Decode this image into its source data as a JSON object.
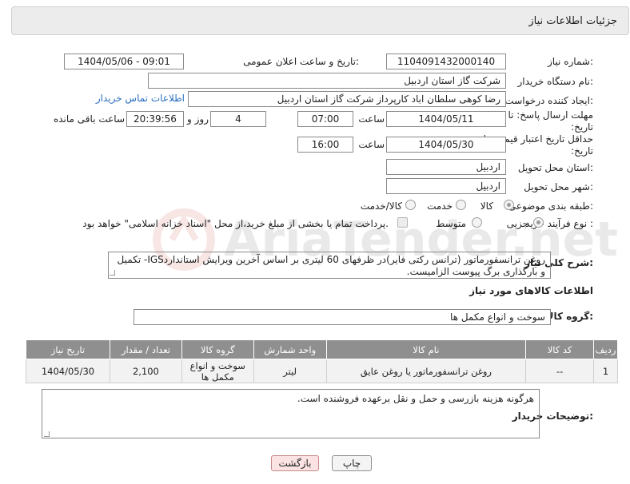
{
  "header": {
    "title": "جزئیات اطلاعات نیاز"
  },
  "form": {
    "need_number_label": "شماره نیاز:",
    "need_number": "1104091432000140",
    "announce_label": "تاریخ و ساعت اعلان عمومی:",
    "announce_value": "1404/05/06 - 09:01",
    "buyer_org_label": "نام دستگاه خریدار:",
    "buyer_org": "شرکت گاز استان اردبیل",
    "requester_label": "ایجاد کننده درخواست:",
    "requester": "رضا کوهی سلطان اباد کارپرداز شرکت گاز استان اردبیل",
    "contact_link": "اطلاعات تماس خریدار",
    "deadline_label": "مهلت ارسال پاسخ: تا تاریخ:",
    "deadline_date": "1404/05/11",
    "deadline_time_label": "ساعت",
    "deadline_time": "07:00",
    "days_value": "4",
    "days_label": "روز و",
    "remaining_time": "20:39:56",
    "remaining_label": "ساعت باقی مانده",
    "min_validity_label": "حداقل تاریخ اعتبار قیمت: تا تاریخ:",
    "validity_date": "1404/05/30",
    "validity_time_label": "ساعت",
    "validity_time": "16:00",
    "province_label": "استان محل تحویل:",
    "province": "اردبیل",
    "city_label": "شهر محل تحویل:",
    "city": "اردبیل",
    "category_label": "طبقه بندی موضوعی:",
    "category_options": [
      "کالا",
      "خدمت",
      "کالا/خدمت"
    ],
    "category_selected": "کالا",
    "process_label": "نوع فرآیند خرید :",
    "process_options": [
      "جزیی",
      "متوسط"
    ],
    "process_selected": "جزیی",
    "payment_note": "پرداخت تمام یا بخشی از مبلغ خرید،از محل \"اسناد خزانه اسلامی\" خواهد بود.",
    "description_label": "شرح کلی نیاز:",
    "description": "روغن ترانسفورماتور (ترانس رکتی فایر)در ظرفهای 60 لیتری بر اساس آخرین ویرایش استانداردIGS- تکمیل و بارگذاری برگ پیوست الزامیست."
  },
  "goods": {
    "section_title": "اطلاعات کالاهای مورد نیاز",
    "group_label": "گروه کالا:",
    "group_value": "سوخت و انواع مکمل ها",
    "columns": [
      "ردیف",
      "کد کالا",
      "نام کالا",
      "واحد شمارش",
      "گروه کالا",
      "تعداد / مقدار",
      "تاریخ نیاز"
    ],
    "rows": [
      {
        "row": "1",
        "code": "--",
        "name": "روغن ترانسفورماتور یا روغن عایق",
        "unit": "لیتر",
        "group": "سوخت و انواع مکمل ها",
        "qty": "2,100",
        "date": "1404/05/30"
      }
    ]
  },
  "buyer_notes": {
    "label": "توضیحات خریدار:",
    "text": "هرگونه هزینه بازرسی و حمل و نقل برعهده فروشنده است."
  },
  "buttons": {
    "print": "چاپ",
    "back": "بازگشت"
  },
  "watermark_text": "AriaTender.net",
  "colors": {
    "header_bg": "#ececec",
    "table_header": "#8f8f8f",
    "link": "#2a6fc1",
    "back_button_bg": "#fbe3e3"
  }
}
